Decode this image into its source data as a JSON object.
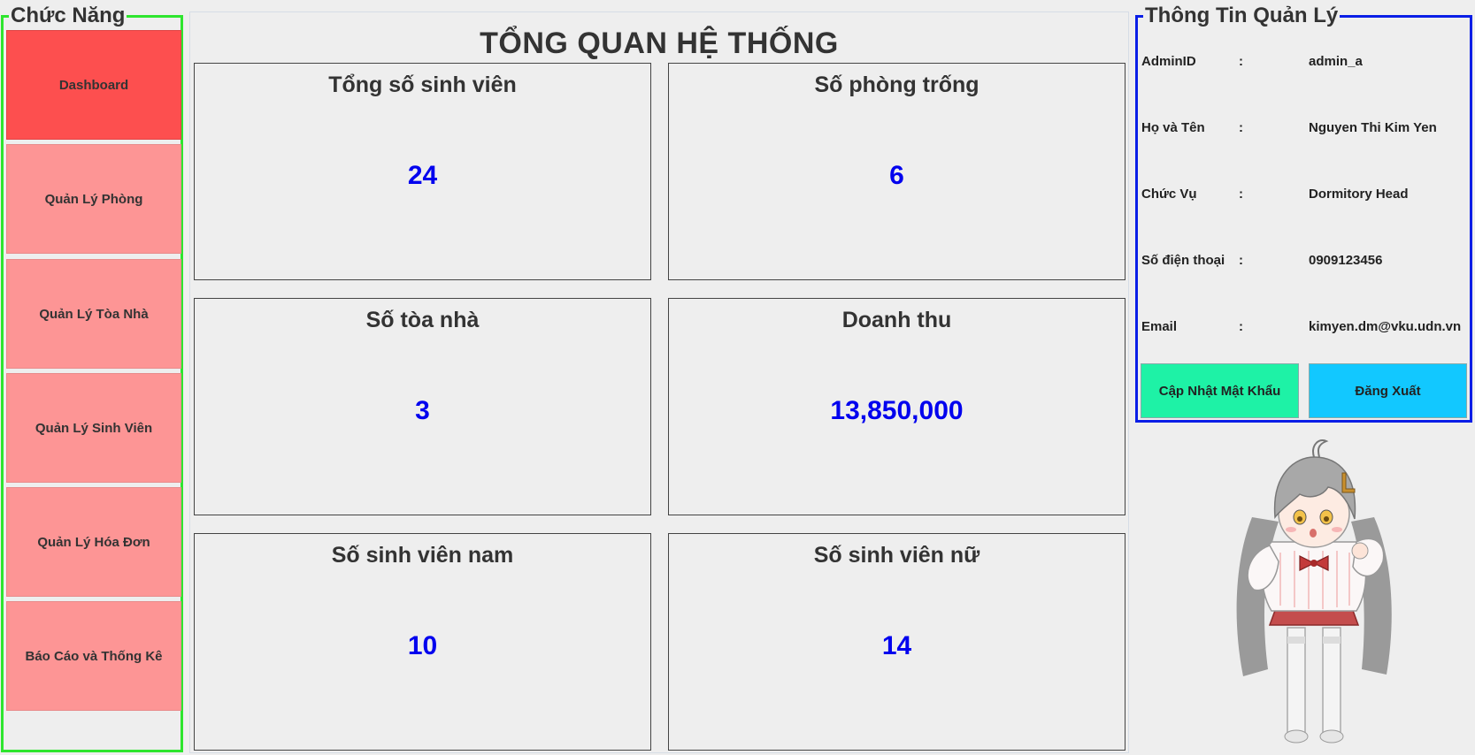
{
  "sidebar": {
    "title": "Chức Năng",
    "items": [
      {
        "label": "Dashboard",
        "active": true
      },
      {
        "label": "Quản Lý Phòng",
        "active": false
      },
      {
        "label": "Quản Lý Tòa Nhà",
        "active": false
      },
      {
        "label": "Quản Lý Sinh Viên",
        "active": false
      },
      {
        "label": "Quản Lý Hóa Đơn",
        "active": false
      },
      {
        "label": "Báo Cáo và Thống Kê",
        "active": false
      }
    ]
  },
  "main": {
    "title": "TỔNG QUAN HỆ THỐNG",
    "cards": [
      {
        "label": "Tổng số sinh viên",
        "value": "24"
      },
      {
        "label": "Số phòng trống",
        "value": "6"
      },
      {
        "label": "Số tòa nhà",
        "value": "3"
      },
      {
        "label": "Doanh thu",
        "value": "13,850,000"
      },
      {
        "label": "Số sinh viên nam",
        "value": "10"
      },
      {
        "label": "Số sinh viên nữ",
        "value": "14"
      }
    ]
  },
  "info": {
    "title": "Thông Tin Quản Lý",
    "separator": ":",
    "rows": [
      {
        "key": "AdminID",
        "value": "admin_a"
      },
      {
        "key": "Họ và Tên",
        "value": "Nguyen Thi Kim Yen"
      },
      {
        "key": "Chức Vụ",
        "value": "Dormitory Head"
      },
      {
        "key": "Số điện thoại",
        "value": "0909123456"
      },
      {
        "key": "Email",
        "value": "kimyen.dm@vku.udn.vn"
      }
    ],
    "update_password_label": "Cập Nhật Mật Khẩu",
    "logout_label": "Đăng Xuất"
  },
  "colors": {
    "sidebar_border": "#2ee52e",
    "info_border": "#0a1ee6",
    "nav_active": "#fd4f4f",
    "nav_inactive": "#fd9595",
    "value_text": "#0000ee",
    "update_button": "#1ef2a6",
    "logout_button": "#12c8ff"
  },
  "icons": {
    "mascot": "anime-girl-mascot"
  }
}
